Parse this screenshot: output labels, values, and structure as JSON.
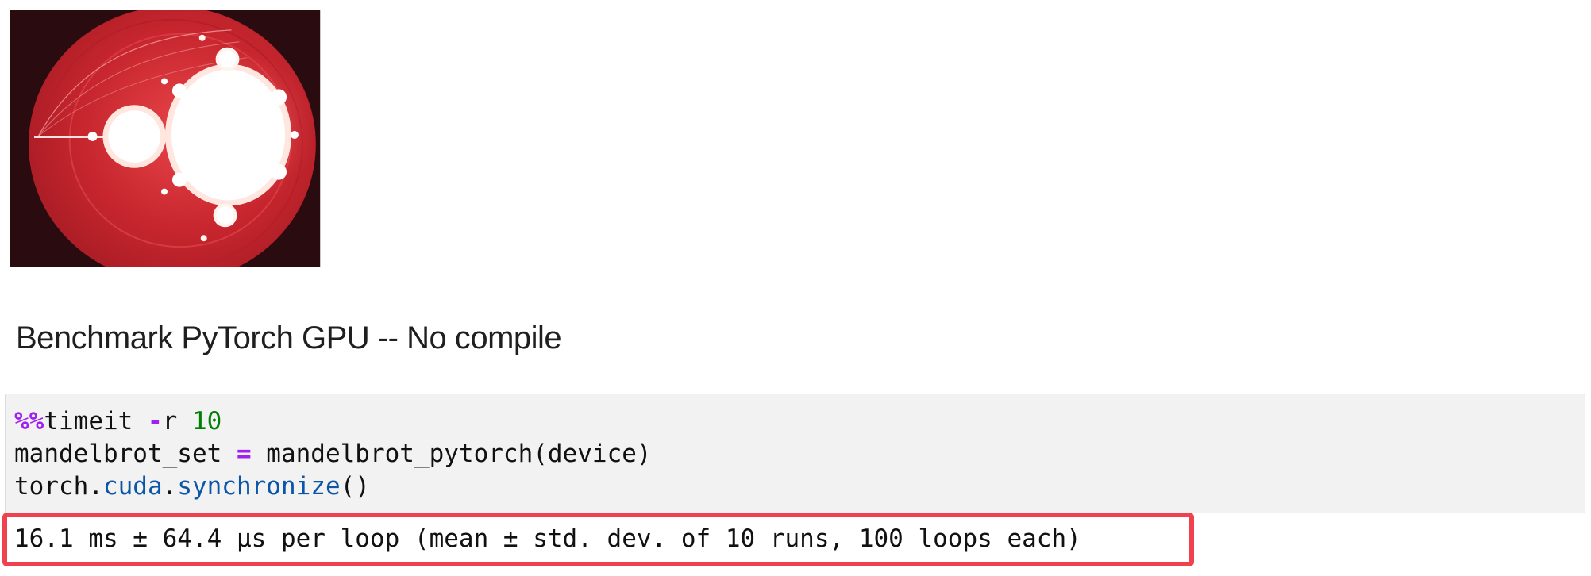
{
  "notebook": {
    "image_output": {
      "alt": "Mandelbrot set render",
      "colors": {
        "background": "#2a0c10",
        "ellipse": "#c8262e",
        "set": "#ffffff"
      }
    },
    "heading": {
      "text": "Benchmark PyTorch GPU -- No compile"
    },
    "code_cell": {
      "line1": {
        "magic": "%%",
        "cmd": "timeit ",
        "flag_op": "-",
        "flag": "r ",
        "num": "10"
      },
      "line2": {
        "var": "mandelbrot_set ",
        "op": "=",
        "call": " mandelbrot_pytorch(device)"
      },
      "line3": {
        "obj": "torch.",
        "attr1": "cuda",
        "dot": ".",
        "attr2": "synchronize",
        "parens": "()"
      }
    },
    "output": {
      "text": "16.1 ms ± 64.4 µs per loop (mean ± std. dev. of 10 runs, 100 loops each)",
      "highlight_color": "#f0414f"
    }
  }
}
